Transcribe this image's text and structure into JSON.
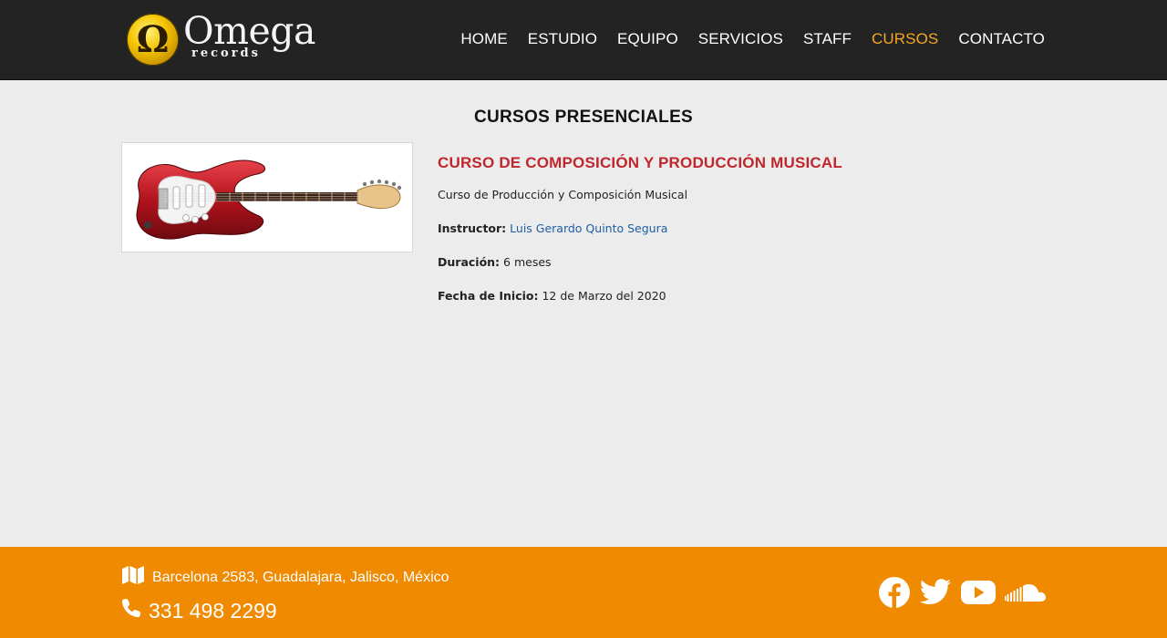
{
  "brand": {
    "name": "Omega",
    "sub": "records"
  },
  "nav": [
    {
      "label": "HOME",
      "active": false
    },
    {
      "label": "ESTUDIO",
      "active": false
    },
    {
      "label": "EQUIPO",
      "active": false
    },
    {
      "label": "SERVICIOS",
      "active": false
    },
    {
      "label": "STAFF",
      "active": false
    },
    {
      "label": "CURSOS",
      "active": true
    },
    {
      "label": "CONTACTO",
      "active": false
    }
  ],
  "page": {
    "title": "CURSOS PRESENCIALES"
  },
  "course": {
    "image_icon": "electric-guitar-image",
    "title": "CURSO DE COMPOSICIÓN Y PRODUCCIÓN MUSICAL",
    "description": "Curso de Producción y Composición Musical",
    "instructor_label": "Instructor:",
    "instructor": "Luis Gerardo Quinto Segura",
    "duration_label": "Duración:",
    "duration": "6 meses",
    "start_label": "Fecha de Inicio:",
    "start": "12 de Marzo del 2020"
  },
  "footer": {
    "address": "Barcelona 2583, Guadalajara, Jalisco, México",
    "phone": "331 498 2299",
    "social": [
      "facebook-icon",
      "twitter-icon",
      "youtube-icon",
      "soundcloud-icon"
    ]
  },
  "colors": {
    "header_bg": "#232323",
    "accent": "#f5a623",
    "footer_bg": "#f08a00",
    "course_title": "#c0272d",
    "link": "#1f5fa5",
    "page_bg": "#ececec"
  }
}
